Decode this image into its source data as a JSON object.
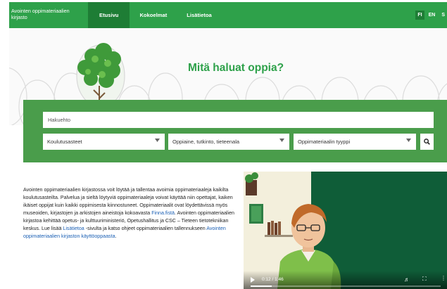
{
  "header": {
    "brand_line1": "Avointen oppimateriaalien",
    "brand_line2": "kirjasto",
    "nav": [
      {
        "label": "Etusivu",
        "active": true
      },
      {
        "label": "Kokoelmat",
        "active": false
      },
      {
        "label": "Lisätietoa",
        "active": false
      }
    ],
    "languages": [
      {
        "label": "FI",
        "active": true
      },
      {
        "label": "EN",
        "active": false
      },
      {
        "label": "S",
        "active": false
      }
    ]
  },
  "hero": {
    "title": "Mitä haluat oppia?"
  },
  "search": {
    "placeholder": "Hakuehto",
    "filters": [
      {
        "label": "Koulutusasteet"
      },
      {
        "label": "Oppiaine, tutkinto, tieteenala"
      },
      {
        "label": "Oppimateriaalin tyyppi"
      }
    ]
  },
  "intro": {
    "text1": "Avointen oppimateriaalien kirjastossa voit löytää ja tallentaa avoimia oppimateriaaleja kaikilta koulutusasteilta. Palvelua ja sieltä löytyviä oppimateriaaleja voivat käyttää niin opettajat, kaiken ikäiset oppijat kuin kaikki oppimisesta kiinnostuneet. Oppimateriaalit ovat löydettävissä myös museoiden, kirjastojen ja arkistojen aineistoja kokoavasta ",
    "link1": "Finna.fistä",
    "text2": ". Avointen oppimateriaalien kirjastoa kehittää opetus- ja kulttuuriministeriö, Opetushallitus ja CSC – Tieteen tietotekniikan keskus. Lue lisää ",
    "link2": "Lisätietoa",
    "text3": " -sivulta ja katso ohjeet oppimateriaalien tallennukseen ",
    "link3": "Avointen oppimateriaalien kirjaston käyttöoppaasta",
    "text4": "."
  },
  "video": {
    "time": "0:12 / 1:46",
    "progress": 0.11,
    "colors": {
      "background": "#0f5d38",
      "wall": "#f3efdc"
    }
  },
  "colors": {
    "brand": "#2ea14a",
    "brand_dark": "#1e7d35",
    "search_panel": "#4a9d4b",
    "link": "#1a5fb4"
  },
  "icons": {
    "search": "magnifier-icon",
    "dropdown": "chevron-down-icon"
  }
}
